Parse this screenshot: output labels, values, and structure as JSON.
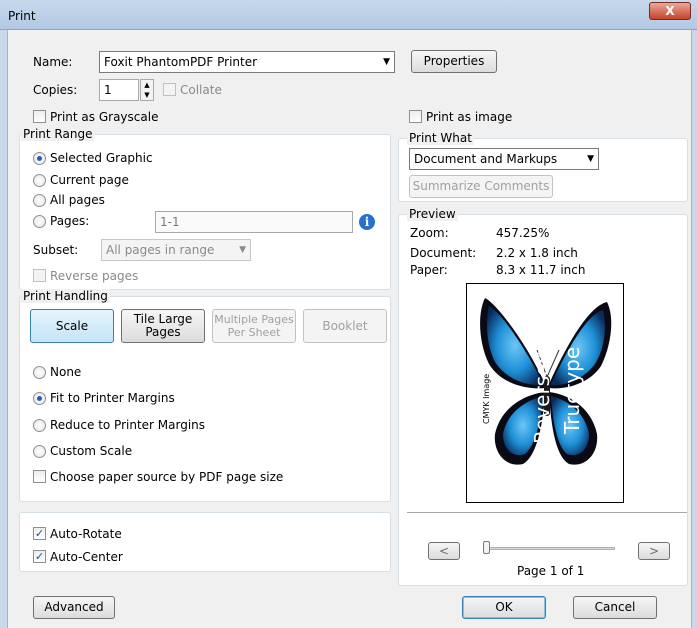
{
  "window": {
    "title": "Print",
    "close_symbol": "X"
  },
  "printer": {
    "name_label": "Name:",
    "name_value": "Foxit PhantomPDF Printer",
    "properties_label": "Properties",
    "copies_label": "Copies:",
    "copies_value": "1",
    "collate_label": "Collate",
    "grayscale_label": "Print as Grayscale",
    "print_as_image_label": "Print as image"
  },
  "print_range": {
    "title": "Print Range",
    "options": [
      "Selected Graphic",
      "Current page",
      "All pages",
      "Pages:"
    ],
    "selected": "Selected Graphic",
    "pages_value": "1-1",
    "subset_label": "Subset:",
    "subset_value": "All pages in range",
    "reverse_label": "Reverse pages"
  },
  "print_handling": {
    "title": "Print Handling",
    "tabs": {
      "scale": "Scale",
      "tile_large": "Tile Large\nPages",
      "multiple_pages": "Multiple Pages\nPer Sheet",
      "booklet": "Booklet"
    },
    "scale_options": [
      "None",
      "Fit to Printer Margins",
      "Reduce to Printer Margins",
      "Custom Scale"
    ],
    "selected": "Fit to Printer Margins",
    "paper_source_label": "Choose paper source by PDF page size"
  },
  "auto": {
    "rotate_label": "Auto-Rotate",
    "rotate_checked": true,
    "center_label": "Auto-Center",
    "center_checked": true
  },
  "print_what": {
    "title": "Print What",
    "value": "Document and Markups",
    "summarize_label": "Summarize Comments"
  },
  "preview": {
    "title": "Preview",
    "zoom_label": "Zoom:",
    "zoom_value": "457.25%",
    "document_label": "Document:",
    "document_value": "2.2 x 1.8 inch",
    "paper_label": "Paper:",
    "paper_value": "8.3 x 11.7 inch",
    "image_text_1": "Reversed",
    "image_text_2": "Truetype",
    "image_text_3": "CMYK Image",
    "prev_label": "<",
    "next_label": ">",
    "page_indicator": "Page 1 of 1"
  },
  "footer": {
    "advanced_label": "Advanced",
    "ok_label": "OK",
    "cancel_label": "Cancel"
  },
  "colors": {
    "accent": "#2a5db0",
    "butterfly_blue": "#1e8fd6",
    "butterfly_dark": "#0a0a14"
  }
}
